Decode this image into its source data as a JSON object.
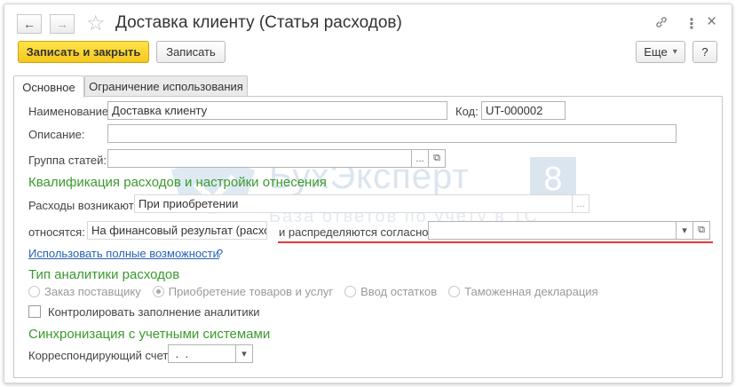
{
  "window": {
    "title": "Доставка клиенту (Статья расходов)",
    "nav_back": "←",
    "nav_forward": "→",
    "star": "☆",
    "link_icon": "🔗",
    "more_icon": "⋮",
    "close_icon": "×"
  },
  "toolbar": {
    "save_close_label": "Записать и закрыть",
    "save_label": "Записать",
    "more_label": "Еще",
    "more_arrow": "▾",
    "help_label": "?"
  },
  "tabs": [
    {
      "label": "Основное",
      "active": true
    },
    {
      "label": "Ограничение использования",
      "active": false
    }
  ],
  "form": {
    "name_label": "Наименование:",
    "name_value": "Доставка клиенту",
    "code_label": "Код:",
    "code_value": "UT-000002",
    "description_label": "Описание:",
    "description_value": "",
    "group_label": "Группа статей:",
    "group_value": "",
    "ellipsis": "...",
    "open_icon": "⧉",
    "section_qualification": "Квалификация расходов и настройки отнесения",
    "costs_arise_label": "Расходы возникают:",
    "costs_arise_value": "При приобретении",
    "relate_label": "относятся:",
    "relate_value": "На финансовый результат (расход",
    "distributed_label": "и распределяются согласно:",
    "distributed_value": "",
    "dropdown_arrow": "▾",
    "full_features_link": "Использовать полные возможности",
    "full_features_q": "?",
    "section_analytics": "Тип аналитики расходов",
    "analytics_options": [
      {
        "label": "Заказ поставщику",
        "selected": false
      },
      {
        "label": "Приобретение товаров и услуг",
        "selected": true
      },
      {
        "label": "Ввод остатков",
        "selected": false
      },
      {
        "label": "Таможенная декларация",
        "selected": false
      }
    ],
    "control_label": "Контролировать заполнение аналитики",
    "section_sync": "Синхронизация с учетными системами",
    "corr_account_label": "Корреспондирующий счет:",
    "corr_account_value": " .  ."
  },
  "watermark": {
    "brand": "БухЭксперт",
    "number": "8",
    "tagline": "База ответов по учету в 1С"
  }
}
